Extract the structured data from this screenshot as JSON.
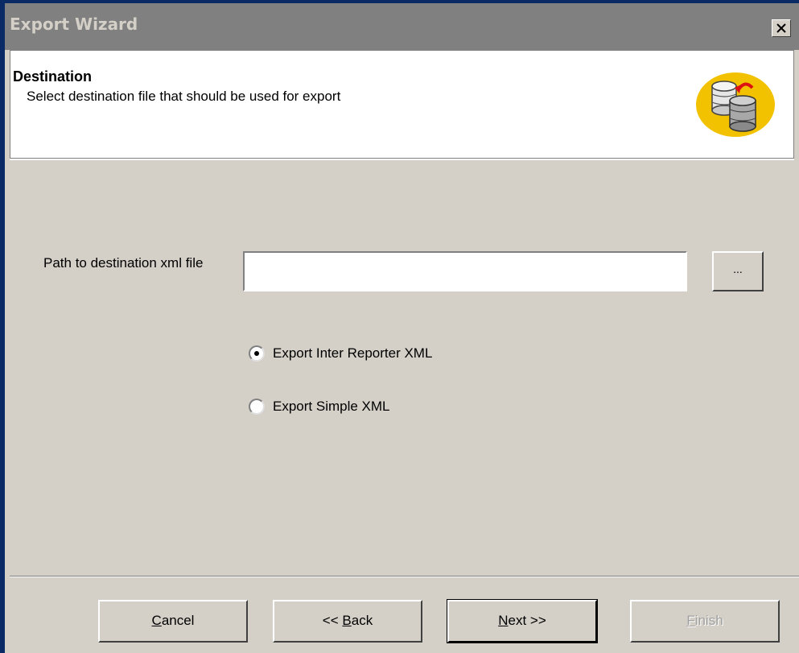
{
  "window": {
    "title": "Export Wizard"
  },
  "header": {
    "title": "Destination",
    "subtitle": "Select destination file that should be used for export",
    "icon": "database-export-icon"
  },
  "form": {
    "path_label": "Path to destination xml file",
    "path_value": "",
    "browse_label": "...",
    "options": [
      {
        "label": "Export Inter Reporter XML",
        "checked": true
      },
      {
        "label": "Export Simple XML",
        "checked": false
      }
    ]
  },
  "buttons": {
    "cancel": {
      "underline": "C",
      "rest": "ancel"
    },
    "back": {
      "prefix": "<< ",
      "underline": "B",
      "rest": "ack"
    },
    "next": {
      "underline": "N",
      "rest": "ext >>"
    },
    "finish": {
      "underline": "F",
      "rest": "inish",
      "disabled": true
    }
  },
  "colors": {
    "window_frame": "#0a2a66",
    "titlebar": "#808080",
    "face": "#d4d0c8",
    "icon_circle": "#f2c200"
  }
}
